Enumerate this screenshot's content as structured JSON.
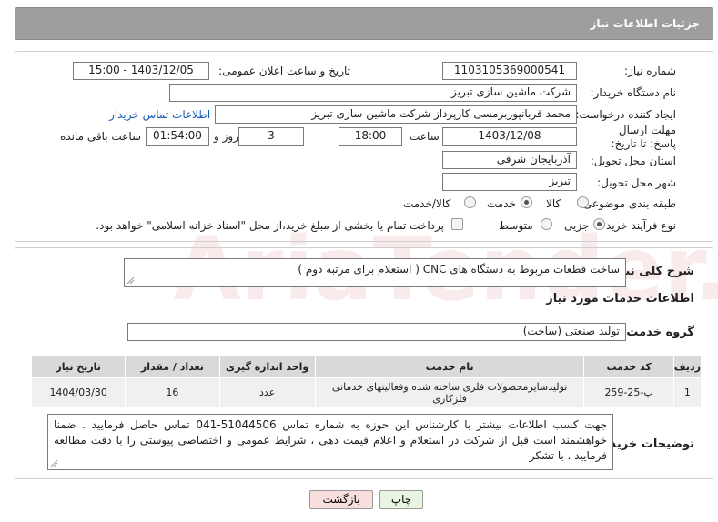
{
  "watermark": "AriaTender.neT",
  "header": {
    "title": "جزئیات اطلاعات نیاز"
  },
  "form": {
    "need_number_label": "شماره نیاز:",
    "need_number": "1103105369000541",
    "announce_label": "تاریخ و ساعت اعلان عمومی:",
    "announce_value": "1403/12/05 - 15:00",
    "buyer_org_label": "نام دستگاه خریدار:",
    "buyer_org": "شرکت ماشین سازی تبریز",
    "creator_label": "ایجاد کننده درخواست:",
    "creator": "محمد قربانپوربرمسی کارپرداز شرکت ماشین سازی تبریز",
    "contact_link": "اطلاعات تماس خریدار",
    "deadline_label": "مهلت ارسال پاسخ: تا تاریخ:",
    "deadline_date": "1403/12/08",
    "time_label": "ساعت",
    "deadline_time": "18:00",
    "days_value": "3",
    "days_label": "روز و",
    "remaining_time": "01:54:00",
    "remaining_label": "ساعت باقی مانده",
    "province_label": "استان محل تحویل:",
    "province": "آذربایجان شرقی",
    "city_label": "شهر محل تحویل:",
    "city": "تبریز",
    "category_label": "طبقه بندی موضوعی:",
    "category_options": [
      "کالا",
      "خدمت",
      "کالا/خدمت"
    ],
    "category_selected": 1,
    "process_label": "نوع فرآیند خرید :",
    "process_options": [
      "جزیی",
      "متوسط"
    ],
    "process_selected": 0,
    "payment_note": "پرداخت تمام یا بخشی از مبلغ خرید،از محل \"اسناد خزانه اسلامی\" خواهد بود."
  },
  "summary": {
    "label": "شرح کلی نیاز:",
    "text": "ساخت قطعات مربوط به دستگاه های CNC ( استعلام برای مرتبه دوم )"
  },
  "services": {
    "section_title": "اطلاعات خدمات مورد نیاز",
    "group_label": "گروه خدمت:",
    "group_value": "تولید صنعتی (ساخت)",
    "columns": [
      "ردیف",
      "کد خدمت",
      "نام خدمت",
      "واحد اندازه گیری",
      "تعداد / مقدار",
      "تاریخ نیاز"
    ],
    "rows": [
      [
        "1",
        "پ-25-259",
        "تولیدسایرمحصولات فلزی ساخته شده وفعالیتهای خدماتی فلزکاری",
        "عدد",
        "16",
        "1404/03/30"
      ]
    ]
  },
  "buyer_notes": {
    "label": "توضیحات خریدار:",
    "text": "جهت کسب اطلاعات بیشتر با کارشناس این حوزه به شماره تماس 51044506-041 تماس حاصل فرمایید . ضمنا خواهشمند است قبل از شرکت در استعلام و اعلام قیمت دهی ، شرایط عمومی و اختصاصی پیوستی را با دقت مطالعه فرمایید . با تشکر"
  },
  "buttons": {
    "print": "چاپ",
    "back": "بازگشت"
  }
}
